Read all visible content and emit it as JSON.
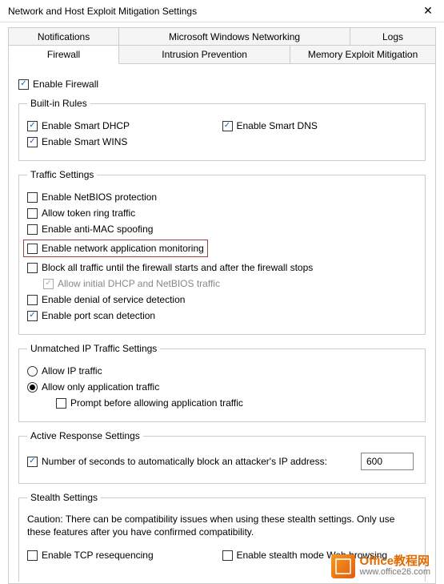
{
  "window": {
    "title": "Network and Host Exploit Mitigation Settings",
    "close_glyph": "✕"
  },
  "tabs": {
    "row1": [
      "Notifications",
      "Microsoft Windows Networking",
      "Logs"
    ],
    "row2": [
      "Firewall",
      "Intrusion Prevention",
      "Memory Exploit Mitigation"
    ],
    "active": "Firewall"
  },
  "top_checkbox": {
    "label": "Enable Firewall",
    "checked": true
  },
  "groups": {
    "built_in": {
      "legend": "Built-in Rules",
      "items": [
        {
          "key": "smart_dhcp",
          "label": "Enable Smart DHCP",
          "checked": true
        },
        {
          "key": "smart_dns",
          "label": "Enable Smart DNS",
          "checked": true
        },
        {
          "key": "smart_wins",
          "label": "Enable Smart WINS",
          "checked": true
        }
      ]
    },
    "traffic": {
      "legend": "Traffic Settings",
      "items": [
        {
          "key": "netbios",
          "label": "Enable NetBIOS protection",
          "checked": false
        },
        {
          "key": "tokenring",
          "label": "Allow token ring traffic",
          "checked": false
        },
        {
          "key": "antimac",
          "label": "Enable anti-MAC spoofing",
          "checked": false
        },
        {
          "key": "netappmon",
          "label": "Enable network application monitoring",
          "checked": false,
          "highlight": true
        },
        {
          "key": "blockall",
          "label": "Block all traffic until the firewall starts and after the firewall stops",
          "checked": false
        },
        {
          "key": "allowinitial",
          "label": "Allow initial DHCP and NetBIOS traffic",
          "checked": true,
          "disabled": true,
          "indent": true
        },
        {
          "key": "dos",
          "label": "Enable denial of service detection",
          "checked": false
        },
        {
          "key": "portscan",
          "label": "Enable port scan detection",
          "checked": true
        }
      ]
    },
    "unmatched": {
      "legend": "Unmatched IP Traffic Settings",
      "radios": [
        {
          "key": "allowip",
          "label": "Allow IP traffic",
          "checked": false
        },
        {
          "key": "allowapp",
          "label": "Allow only application traffic",
          "checked": true
        }
      ],
      "sub": {
        "key": "prompt",
        "label": "Prompt before allowing application traffic",
        "checked": false
      }
    },
    "active_response": {
      "legend": "Active Response Settings",
      "item": {
        "label": "Number of seconds to automatically block an attacker's IP address:",
        "checked": true
      },
      "value": "600"
    },
    "stealth": {
      "legend": "Stealth Settings",
      "caution": "Caution: There can be compatibility issues when using these stealth settings. Only use these features after you have confirmed compatibility.",
      "items": [
        {
          "key": "tcpreseq",
          "label": "Enable TCP resequencing",
          "checked": false
        },
        {
          "key": "stealthmode",
          "label": "Enable stealth mode Web browsing",
          "checked": false
        }
      ]
    }
  },
  "watermark": {
    "line1": "Office教程网",
    "line2": "www.office26.com"
  }
}
